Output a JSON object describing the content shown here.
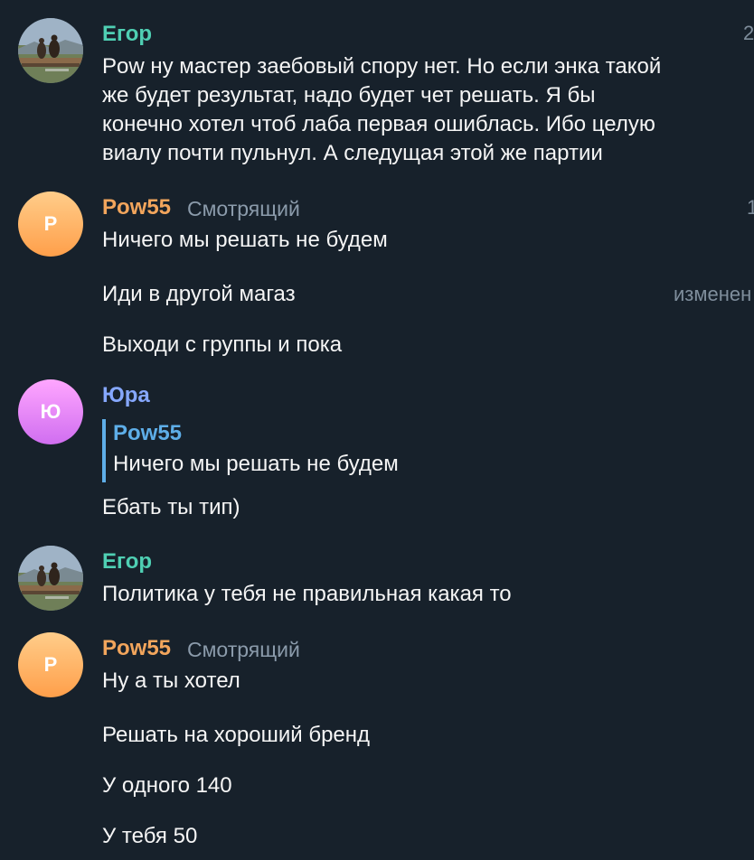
{
  "colors": {
    "background": "#17212b",
    "name_egor": "#4fcfb3",
    "name_pow55": "#f2a55c",
    "name_yura": "#86a8ff",
    "reply_accent": "#5eaee8",
    "message_text": "#f5f5f5",
    "secondary_text": "#8b9bab"
  },
  "messages": [
    {
      "sender": "Егор",
      "avatar_icon": "photo-avatar-icon",
      "time": "2",
      "lines": [
        "Pow ну мастер заебовый спору нет. Но если энка такой",
        "же будет результат, надо будет чет решать. Я бы",
        "конечно хотел чтоб лаба первая ошиблась. Ибо целую",
        "виалу почти пульнул. А следущая этой же партии"
      ]
    },
    {
      "sender": "Pow55",
      "role": "Смотрящий",
      "avatar_letter": "P",
      "time": "1",
      "texts": [
        "Ничего мы решать не будем",
        "Иди в другой магаз",
        "Выходи с группы и пока"
      ],
      "edited_label": "изменен"
    },
    {
      "sender": "Юра",
      "avatar_letter": "Ю",
      "reply": {
        "sender": "Pow55",
        "text": "Ничего мы решать не будем"
      },
      "text": "Ебать ты тип)"
    },
    {
      "sender": "Егор",
      "avatar_icon": "photo-avatar-icon",
      "text": "Политика у тебя не правильная какая то"
    },
    {
      "sender": "Pow55",
      "role": "Смотрящий",
      "avatar_letter": "P",
      "texts": [
        "Ну а ты хотел",
        "Решать на хороший бренд",
        "У одного 140",
        "У тебя 50"
      ]
    }
  ]
}
